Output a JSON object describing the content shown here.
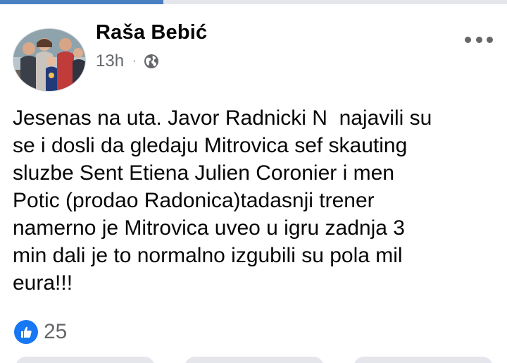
{
  "post": {
    "author_name": "Raša Bebić",
    "timestamp": "13h",
    "separator": "·",
    "privacy_icon": "globe-icon",
    "more_icon": "more-horizontal-icon",
    "avatar_icon": "family-photo",
    "text": "Jesenas na uta. Javor Radnicki N  najavili su\nse i dosli da gledaju Mitrovica sef skauting\nsluzbe Sent Etiena Julien Coronier i men\nPotic (prodao Radonica)tadasnji trener\nnamerno je Mitrovica uveo u igru zadnja 3\nmin dali je to normalno izgubili su pola mil\neura!!!",
    "reactions": {
      "icon": "like-icon",
      "count": "25"
    }
  },
  "colors": {
    "accent": "#1877f2",
    "meta_text": "#65676b",
    "text": "#050505",
    "divider": "#e4e6eb"
  }
}
